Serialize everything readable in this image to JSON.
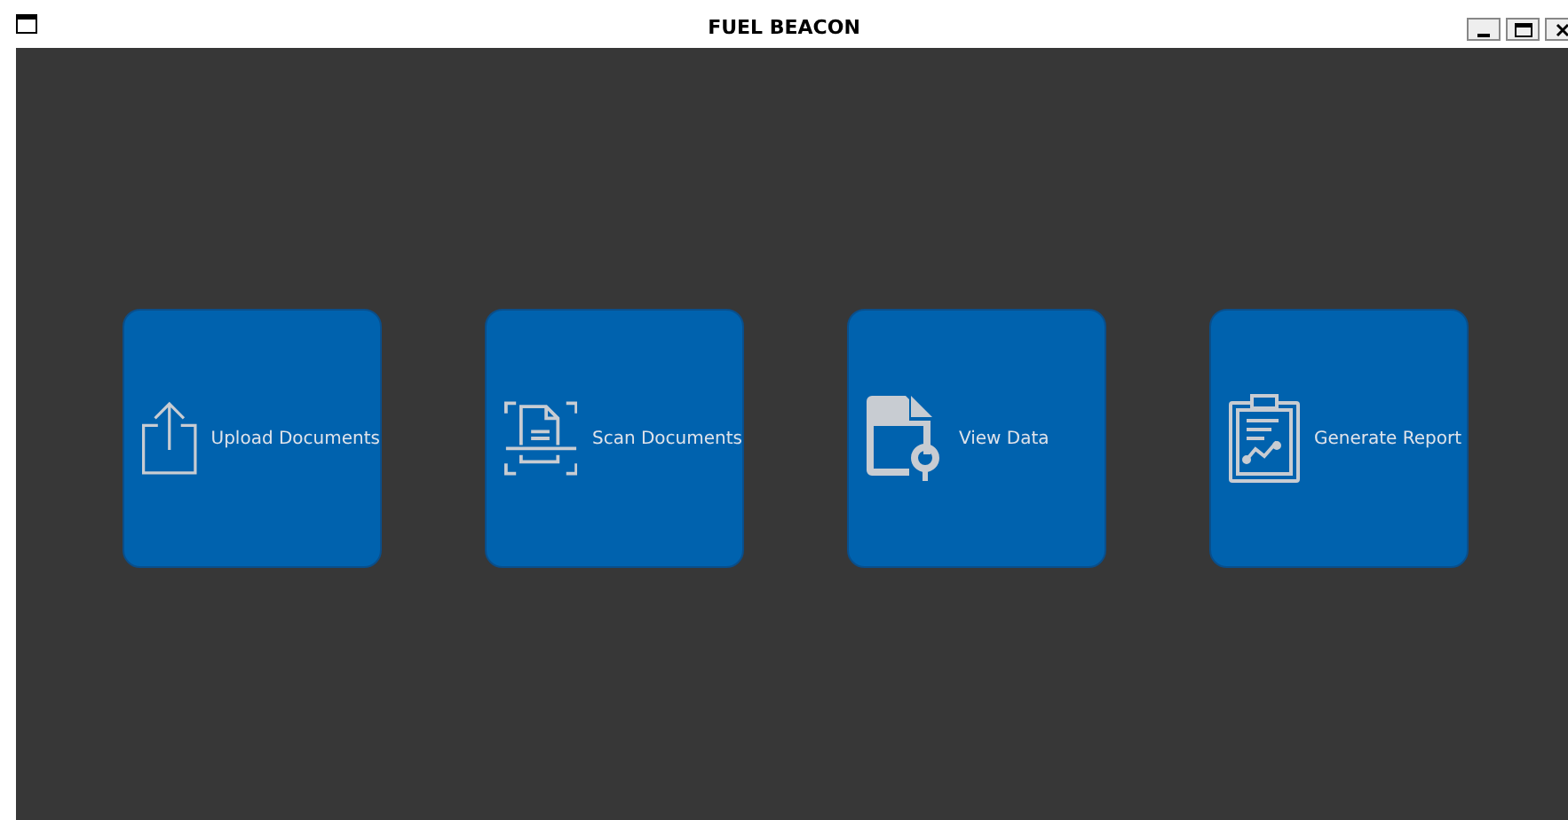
{
  "window": {
    "title": "FUEL BEACON"
  },
  "tiles": [
    {
      "kind": "upload",
      "label": "Upload Documents"
    },
    {
      "kind": "scan",
      "label": "Scan Documents"
    },
    {
      "kind": "view",
      "label": "View Data"
    },
    {
      "kind": "report",
      "label": "Generate Report"
    }
  ]
}
